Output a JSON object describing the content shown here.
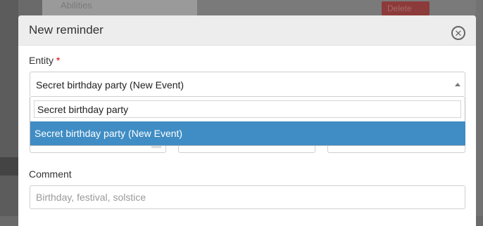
{
  "background": {
    "list_item": "Abilities",
    "red_button": "Delete"
  },
  "modal": {
    "title": "New reminder",
    "close_icon": "close-circle-icon"
  },
  "entity": {
    "label": "Entity",
    "required_mark": "*",
    "selected_value": "Secret birthday party (New Event)",
    "search_value": "Secret birthday party",
    "options": [
      "Secret birthday party (New Event)"
    ]
  },
  "comment": {
    "label": "Comment",
    "placeholder": "Birthday, festival, solstice"
  },
  "colors": {
    "highlight": "#3f8dc4",
    "required": "#dd0000"
  }
}
